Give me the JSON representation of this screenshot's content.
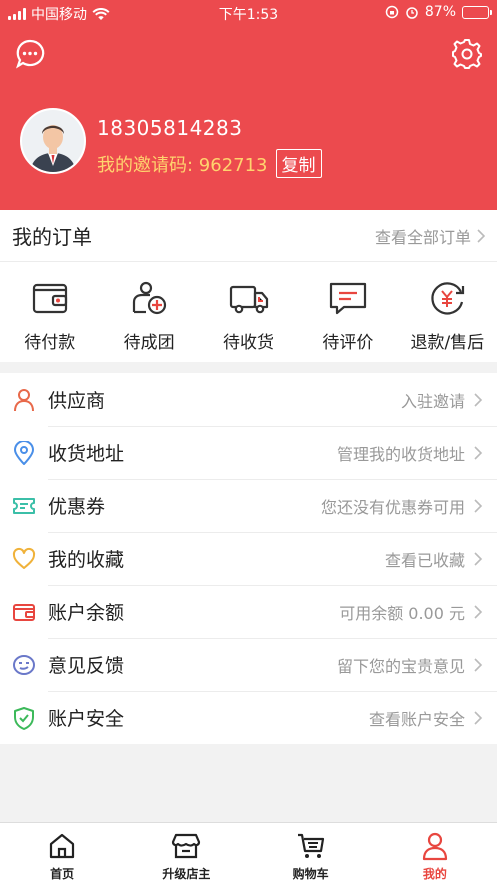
{
  "status_bar": {
    "carrier": "中国移动",
    "time": "下午1:53",
    "battery_percent": "87%",
    "battery_level": 0.87
  },
  "colors": {
    "brand": "#ec4a4e",
    "invite_text": "#ffd36e",
    "active_tab": "#e8463f"
  },
  "profile": {
    "phone": "18305814283",
    "invite_label": "我的邀请码: 962713",
    "copy_label": "复制"
  },
  "orders": {
    "title": "我的订单",
    "view_all": "查看全部订单",
    "items": [
      {
        "label": "待付款",
        "icon": "wallet-icon"
      },
      {
        "label": "待成团",
        "icon": "group-add-icon"
      },
      {
        "label": "待收货",
        "icon": "truck-icon"
      },
      {
        "label": "待评价",
        "icon": "comment-icon"
      },
      {
        "label": "退款/售后",
        "icon": "refund-icon"
      }
    ]
  },
  "menu": [
    {
      "label": "供应商",
      "hint": "入驻邀请",
      "icon": "supplier-icon",
      "color": "#e8694a"
    },
    {
      "label": "收货地址",
      "hint": "管理我的收货地址",
      "icon": "location-icon",
      "color": "#4a8fe8"
    },
    {
      "label": "优惠券",
      "hint": "您还没有优惠券可用",
      "icon": "coupon-icon",
      "color": "#3bbfa8"
    },
    {
      "label": "我的收藏",
      "hint": "查看已收藏",
      "icon": "heart-icon",
      "color": "#f0b23a"
    },
    {
      "label": "账户余额",
      "hint": "可用余额 0.00 元",
      "icon": "balance-wallet-icon",
      "color": "#e8463f"
    },
    {
      "label": "意见反馈",
      "hint": "留下您的宝贵意见",
      "icon": "feedback-icon",
      "color": "#6a78c9"
    },
    {
      "label": "账户安全",
      "hint": "查看账户安全",
      "icon": "shield-icon",
      "color": "#3cb95a"
    }
  ],
  "tabs": [
    {
      "label": "首页",
      "icon": "home-icon"
    },
    {
      "label": "升级店主",
      "icon": "store-icon"
    },
    {
      "label": "购物车",
      "icon": "cart-icon"
    },
    {
      "label": "我的",
      "icon": "user-icon",
      "active": true
    }
  ]
}
